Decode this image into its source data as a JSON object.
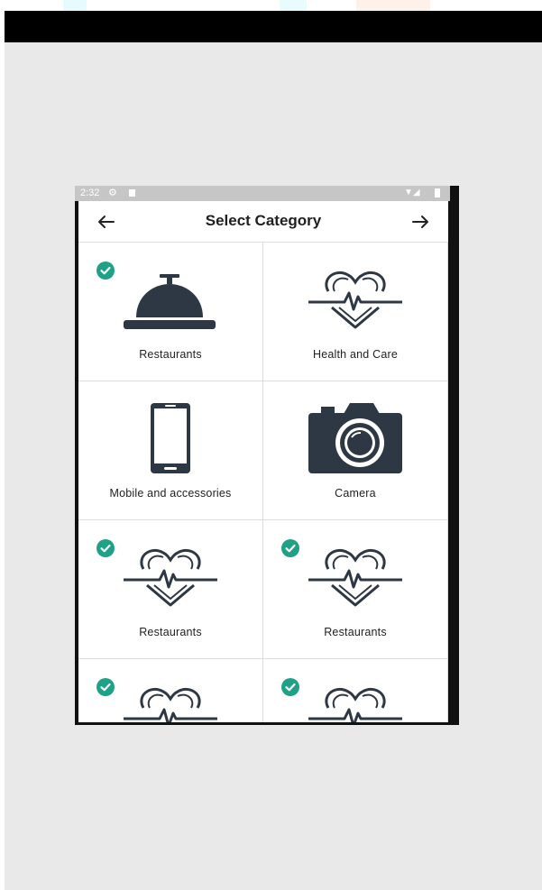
{
  "status_bar": {
    "time": "2:32",
    "icons": [
      "gear-icon",
      "sd-card-icon",
      "wifi-icon",
      "signal-icon",
      "battery-icon"
    ]
  },
  "app_bar": {
    "title": "Select Category",
    "back_icon": "arrow-left-icon",
    "forward_icon": "arrow-right-icon"
  },
  "categories": [
    {
      "label": "Restaurants",
      "icon": "service-bell-icon",
      "selected": true
    },
    {
      "label": "Health and Care",
      "icon": "heart-pulse-icon",
      "selected": false
    },
    {
      "label": "Mobile and accessories",
      "icon": "smartphone-icon",
      "selected": false
    },
    {
      "label": "Camera",
      "icon": "camera-icon",
      "selected": false
    },
    {
      "label": "Restaurants",
      "icon": "heart-pulse-icon",
      "selected": true
    },
    {
      "label": "Restaurants",
      "icon": "heart-pulse-icon",
      "selected": true
    },
    {
      "label": "",
      "icon": "heart-pulse-icon",
      "selected": true
    },
    {
      "label": "",
      "icon": "heart-pulse-icon",
      "selected": true
    }
  ],
  "colors": {
    "accent": "#1fa187",
    "icon": "#2e3744",
    "background": "#e9e9e9"
  }
}
